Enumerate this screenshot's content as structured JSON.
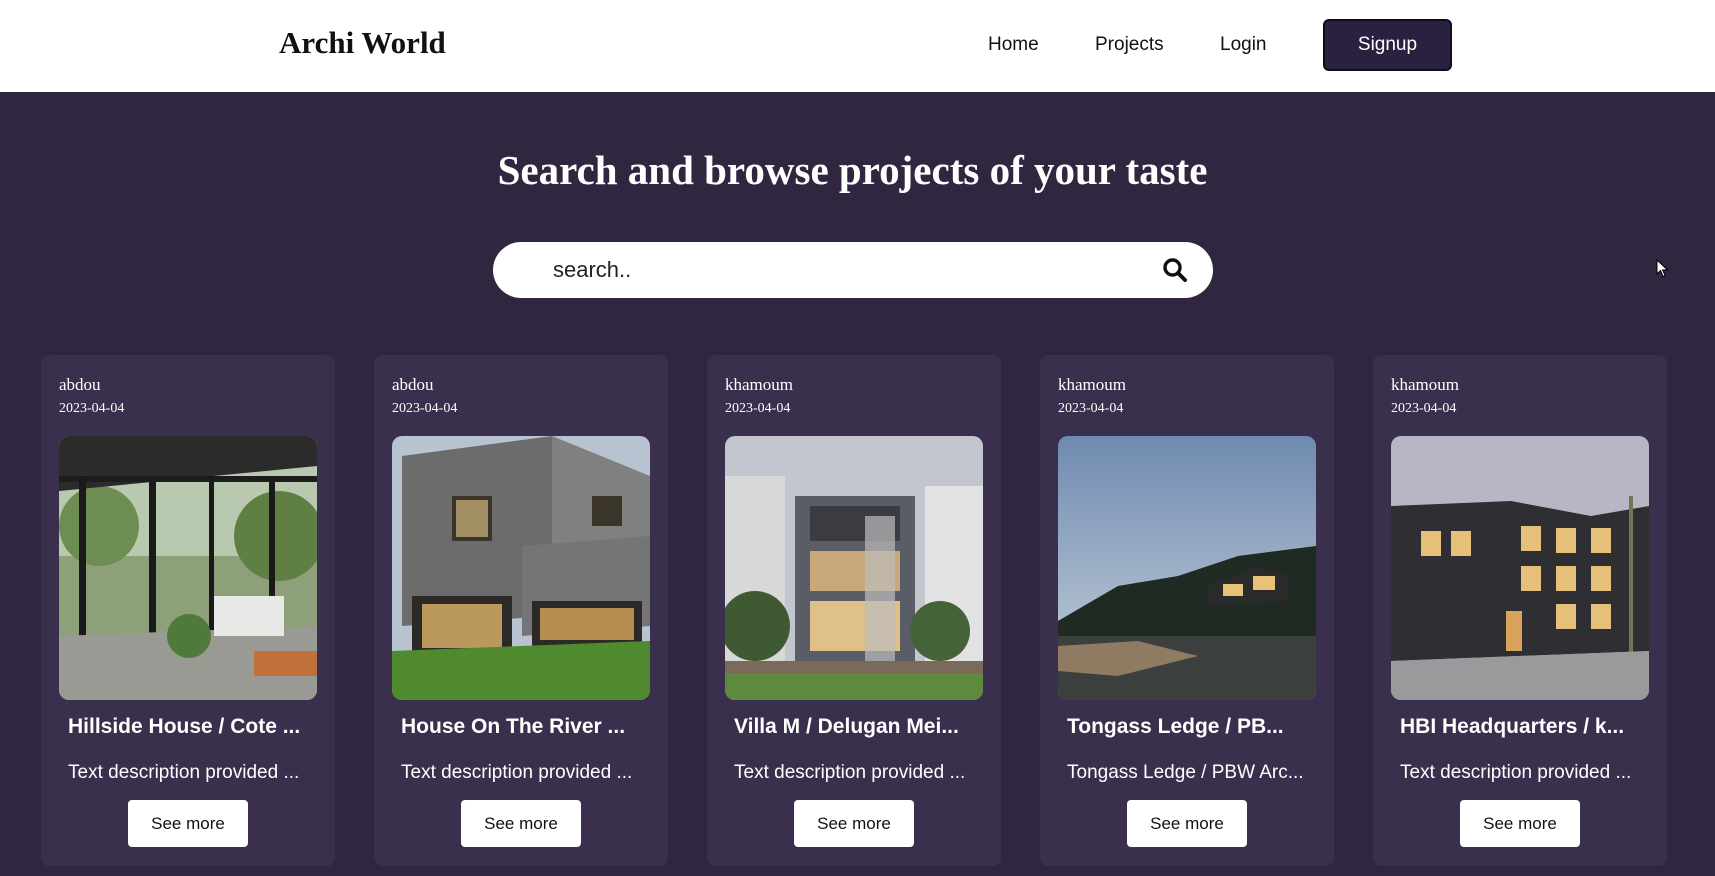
{
  "header": {
    "logo": "Archi World",
    "nav": {
      "home": "Home",
      "projects": "Projects",
      "login": "Login",
      "signup": "Signup"
    }
  },
  "hero": {
    "title": "Search and browse projects of your taste"
  },
  "search": {
    "placeholder": "search..",
    "icon": "search-icon"
  },
  "projects": [
    {
      "author": "abdou",
      "date": "2023-04-04",
      "title": "Hillside House / Cote ...",
      "description": "Text description provided ...",
      "button": "See more"
    },
    {
      "author": "abdou",
      "date": "2023-04-04",
      "title": "House On The River ...",
      "description": "Text description provided ...",
      "button": "See more"
    },
    {
      "author": "khamoum",
      "date": "2023-04-04",
      "title": "Villa M / Delugan Mei...",
      "description": "Text description provided ...",
      "button": "See more"
    },
    {
      "author": "khamoum",
      "date": "2023-04-04",
      "title": "Tongass Ledge / PB...",
      "description": "Tongass Ledge / PBW Arc...",
      "button": "See more"
    },
    {
      "author": "khamoum",
      "date": "2023-04-04",
      "title": "HBI Headquarters / k...",
      "description": "Text description provided ...",
      "button": "See more"
    }
  ],
  "colors": {
    "background": "#30263f",
    "card": "#3a2f4c",
    "signup": "#2a2140"
  }
}
